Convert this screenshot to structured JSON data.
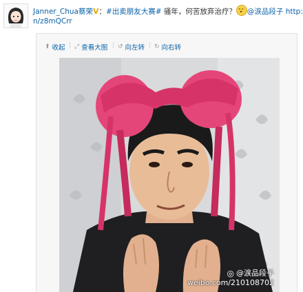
{
  "post": {
    "username": "Janner_Chua蔡荣",
    "verified_badge": "V",
    "hashtag": "#出卖朋友大赛#",
    "text": " 骚年，何苦放弃治疗？",
    "mention": "@涙品段子",
    "url_part1": " http://t.c",
    "url_part2": "n/z8mQCrr"
  },
  "toolbar": {
    "collapse": "收起",
    "view_large": "查看大图",
    "rotate_left": "向左转",
    "rotate_right": "向右转"
  },
  "photo": {
    "watermark_top": "@涙品段子",
    "watermark_bottom": "weibo.com/210108702"
  }
}
